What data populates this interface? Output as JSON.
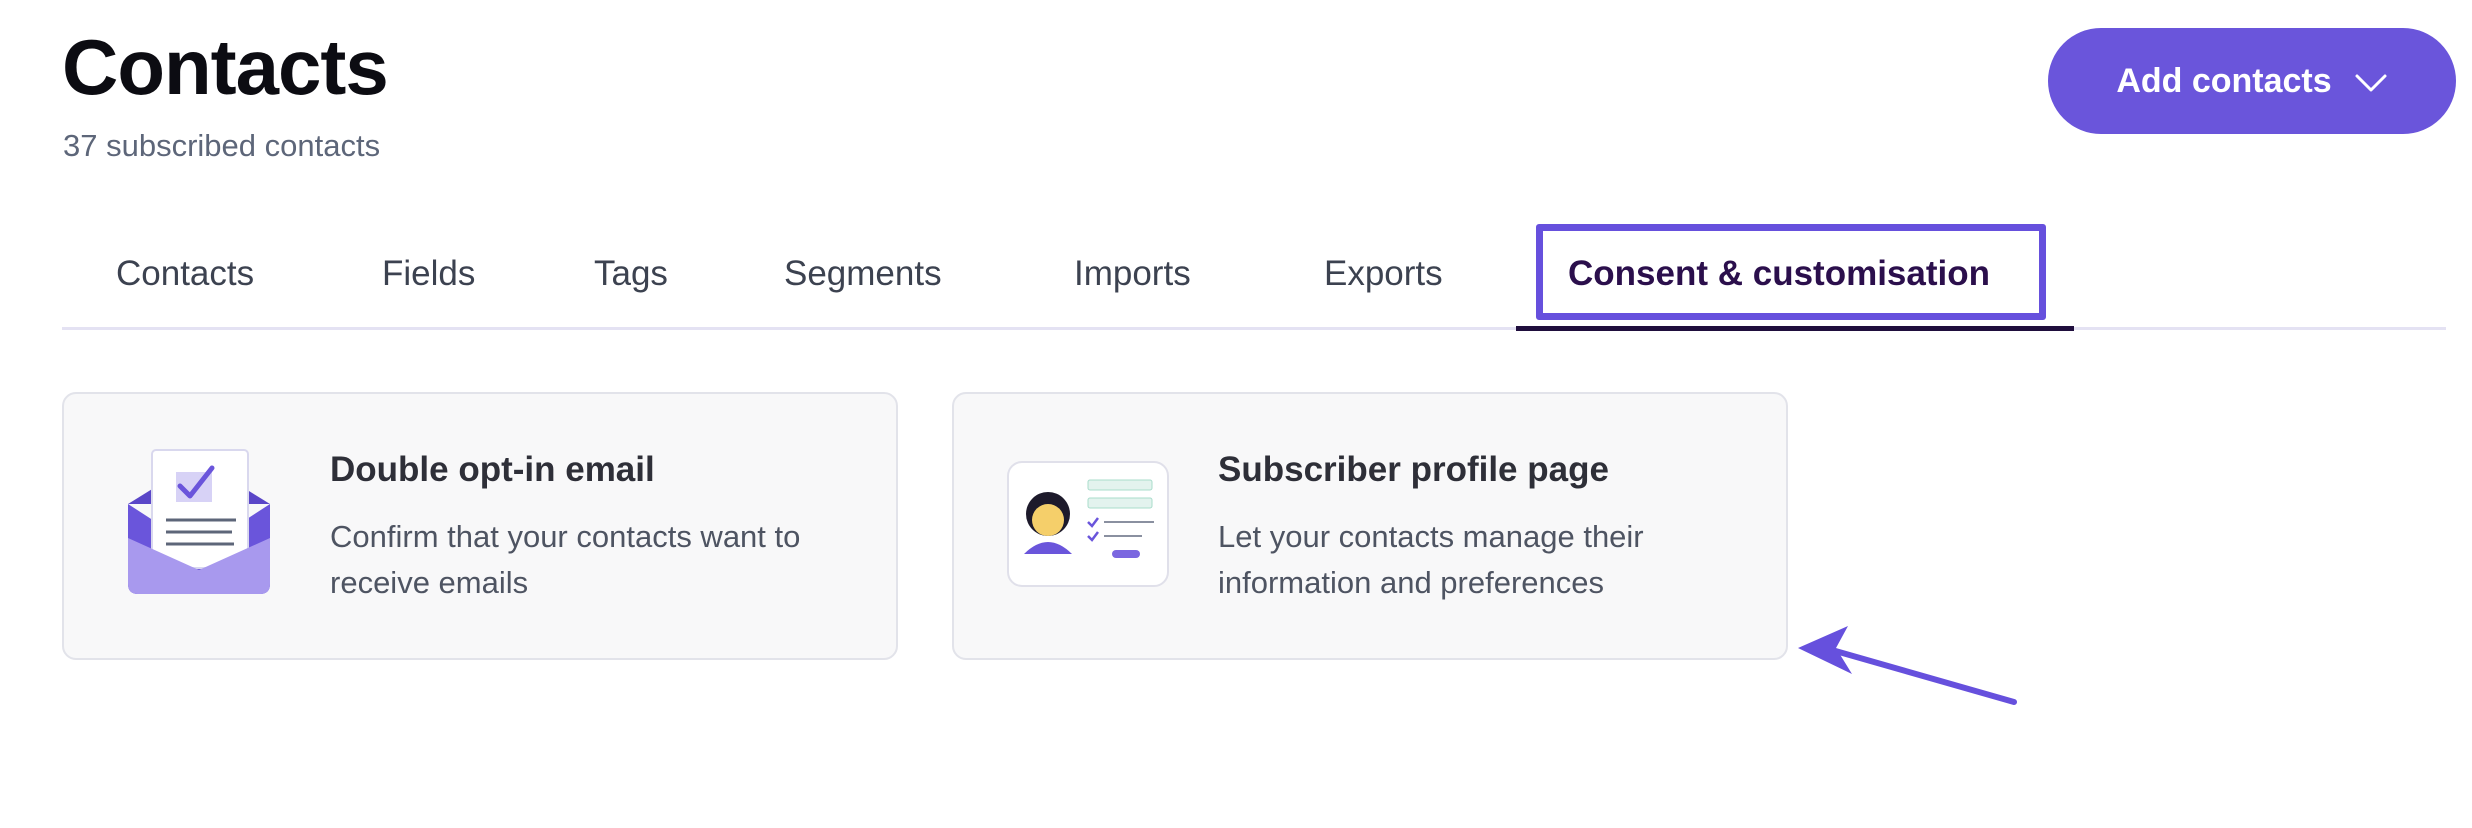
{
  "header": {
    "title": "Contacts",
    "subtitle": "37 subscribed contacts",
    "add_button_label": "Add contacts"
  },
  "tabs": [
    {
      "label": "Contacts",
      "active": false
    },
    {
      "label": "Fields",
      "active": false
    },
    {
      "label": "Tags",
      "active": false
    },
    {
      "label": "Segments",
      "active": false
    },
    {
      "label": "Imports",
      "active": false
    },
    {
      "label": "Exports",
      "active": false
    },
    {
      "label": "Consent & customisation",
      "active": true
    }
  ],
  "cards": [
    {
      "title": "Double opt-in email",
      "description": "Confirm that your contacts want to receive emails",
      "icon": "envelope-checkbox-illustration"
    },
    {
      "title": "Subscriber profile page",
      "description": "Let your contacts manage their information and preferences",
      "icon": "profile-card-illustration"
    }
  ],
  "colors": {
    "accent": "#6a55db",
    "highlight_box": "#6650dd",
    "active_tab_text": "#2b0f4c"
  }
}
